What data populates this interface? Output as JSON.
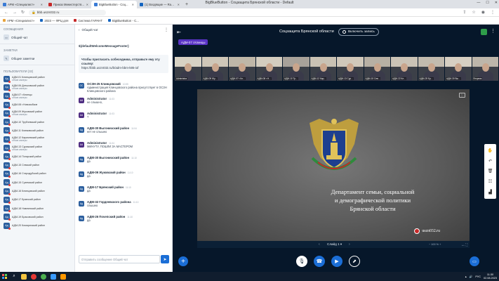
{
  "browser": {
    "window_title": "BigBlueButton - Соцзащита Брянской области - Default",
    "tabs": [
      {
        "label": "АРМ «Специалист»",
        "active": false
      },
      {
        "label": "Приказ Министерства об",
        "active": false
      },
      {
        "label": "BigBlueButton - Соц...",
        "active": true
      },
      {
        "label": "(1) Входящие — Rambler",
        "active": false
      }
    ],
    "url": "bbb.uszn032.ru",
    "bookmarks": [
      "АРМ «Специалист»",
      "2023 — ФРЦ для",
      "Система ГАРАНТ",
      "BigBlueButton - С..."
    ]
  },
  "sidebar": {
    "messages_title": "СООБЩЕНИЯ",
    "public_chat": "Общий чат",
    "notes_title": "ЗАМЕТКИ",
    "shared_notes": "Общие заметки",
    "users_title": "ПОЛЬЗОВАТЕЛИ (32)",
    "users": [
      {
        "initials": "Ад",
        "name": "АДМ-01 Клинцовский район",
        "sub": "объяв камеры"
      },
      {
        "initials": "Ад",
        "name": "АДМ-06 Дятьковский район",
        "sub": "объяв камеры"
      },
      {
        "initials": "Ад",
        "name": "АДМ-07 г.Клинцы",
        "sub": "объяв камеры"
      },
      {
        "initials": "Ад",
        "name": "АДМ-08 г.Новозыбков",
        "sub": ""
      },
      {
        "initials": "Ад",
        "name": "АДМ-09 Жуковский район",
        "sub": "объяв камеры"
      },
      {
        "initials": "Ад",
        "name": "АДМ-10 Трубчевский район",
        "sub": ""
      },
      {
        "initials": "Ад",
        "name": "АДМ-11 Климовский район",
        "sub": ""
      },
      {
        "initials": "Ад",
        "name": "АДМ-12 Карачевский район",
        "sub": "объяв камеры"
      },
      {
        "initials": "Ад",
        "name": "АДМ-13 Суражский район",
        "sub": "объяв камеры"
      },
      {
        "initials": "Ад",
        "name": "АДМ-14 Погарский район",
        "sub": ""
      },
      {
        "initials": "Ад",
        "name": "АДМ-15 Севский район",
        "sub": ""
      },
      {
        "initials": "Ад",
        "name": "АДМ-16 Стародубский район",
        "sub": ""
      },
      {
        "initials": "Ад",
        "name": "АДМ-15 Суземский район",
        "sub": ""
      },
      {
        "initials": "Ад",
        "name": "АДМ-16 Клинцовский район",
        "sub": ""
      },
      {
        "initials": "Ад",
        "name": "АДМ-17 Брянский район",
        "sub": ""
      },
      {
        "initials": "Ад",
        "name": "АДМ-18 Навлинский район",
        "sub": ""
      },
      {
        "initials": "Ад",
        "name": "АДМ-19 Брасовский район",
        "sub": ""
      },
      {
        "initials": "Ад",
        "name": "АДМ-20 Комаричский район",
        "sub": ""
      }
    ]
  },
  "chat": {
    "title": "Общий чат",
    "welcome": "${defaultWelcomeMessageFooter}",
    "invite_title": "Чтобы пригласить собеседника, отправьте ему эту ссылку:",
    "invite_link": "https://bbb.uszn032.ru/b/adm-bbm-k85-iof",
    "messages": [
      {
        "initials": "ОС",
        "name": "ОСЗН-25 Клинцовский",
        "time": "10:55",
        "text": "Администрация Клинцовского района присутствует в ОСЗН Клинцовского района",
        "admin": false
      },
      {
        "initials": "Ad",
        "name": "Administrator",
        "time": "11:03",
        "text": "не слышно,",
        "admin": true
      },
      {
        "initials": "Ad",
        "name": "Administrator",
        "time": "11:03",
        "text": "?",
        "admin": true
      },
      {
        "initials": "Ад",
        "name": "АДМ-30 Выгоничский район",
        "time": "11:04",
        "text": "нет не слышно",
        "admin": false
      },
      {
        "initials": "Ad",
        "name": "Administrator",
        "time": "11:04",
        "text": "МИНУТУ, ПОШЛИ ЗА МАСТЕРОМ",
        "admin": true
      },
      {
        "initials": "Ад",
        "name": "АДМ-30 Выгоничский район",
        "time": "11:10",
        "text": "да",
        "admin": false
      },
      {
        "initials": "Ад",
        "name": "АДМ-09 Жуковский район",
        "time": "11:10",
        "text": "да",
        "admin": false
      },
      {
        "initials": "Ад",
        "name": "АДМ-17 Брянский район",
        "time": "11:10",
        "text": "да",
        "admin": false
      },
      {
        "initials": "Ад",
        "name": "АДМ-32 Гордеевского района",
        "time": "11:10",
        "text": "слышно",
        "admin": false
      },
      {
        "initials": "Ад",
        "name": "АДМ-26 Почепский район",
        "time": "11:10",
        "text": "да",
        "admin": false
      }
    ],
    "input_placeholder": "Отправить сообщение Общий чат"
  },
  "main": {
    "meeting_title": "Соцзащита Брянской области",
    "record_label": "Включить запись",
    "channel_badge": "АДМ-07 г.Клинцы",
    "cameras": [
      {
        "label": "Administra"
      },
      {
        "label": "АДМ-09 Жу..."
      },
      {
        "label": "АДМ-07 г.Кл..."
      },
      {
        "label": "АДМ-08 г.Н..."
      },
      {
        "label": "АДМ-10 Тр..."
      },
      {
        "label": "АДМ-12 Кар..."
      },
      {
        "label": "АДМ-13 Сур..."
      },
      {
        "label": "АДМ-15 Сев..."
      },
      {
        "label": "АДМ-22 Кл..."
      },
      {
        "label": "АДМ-25 Бр..."
      },
      {
        "label": "АДМ-30 Вы..."
      },
      {
        "label": "Вторник"
      }
    ],
    "slide_text": [
      "Департамент семьи, социальной",
      "и демографической политики",
      "Брянской области"
    ],
    "slide_site": "uszn032.ru",
    "slide_label": "Слайд 1",
    "zoom": "100 %"
  },
  "taskbar": {
    "lang": "РУС",
    "time": "11:30",
    "date": "02.08.2023"
  },
  "colors": {
    "accent": "#1b6ed6",
    "dark_bg": "#06172a",
    "channel_badge": "#5a34c6"
  }
}
